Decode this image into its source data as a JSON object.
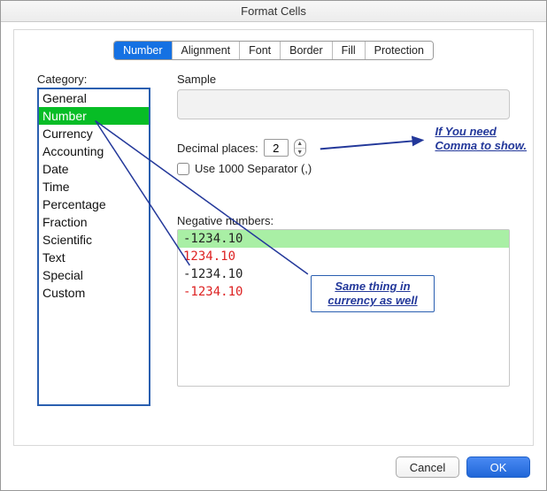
{
  "window": {
    "title": "Format Cells"
  },
  "tabs": [
    {
      "label": "Number"
    },
    {
      "label": "Alignment"
    },
    {
      "label": "Font"
    },
    {
      "label": "Border"
    },
    {
      "label": "Fill"
    },
    {
      "label": "Protection"
    }
  ],
  "category": {
    "label": "Category:",
    "items": [
      "General",
      "Number",
      "Currency",
      "Accounting",
      "Date",
      "Time",
      "Percentage",
      "Fraction",
      "Scientific",
      "Text",
      "Special",
      "Custom"
    ],
    "selected_index": 1
  },
  "right": {
    "sample_label": "Sample",
    "decimal_label": "Decimal places:",
    "decimal_value": "2",
    "separator_label": "Use 1000 Separator (,)",
    "negative_label": "Negative numbers:",
    "negative_items": [
      {
        "text": "-1234.10",
        "red": false,
        "selected": true
      },
      {
        "text": "1234.10",
        "red": true,
        "selected": false
      },
      {
        "text": "-1234.10",
        "red": false,
        "selected": false
      },
      {
        "text": "-1234.10",
        "red": true,
        "selected": false
      }
    ]
  },
  "annotations": {
    "a1_line1": "If You need",
    "a1_line2": "Comma to show.",
    "a2_line1": "Same thing in",
    "a2_line2": "currency as well"
  },
  "buttons": {
    "cancel": "Cancel",
    "ok": "OK"
  }
}
